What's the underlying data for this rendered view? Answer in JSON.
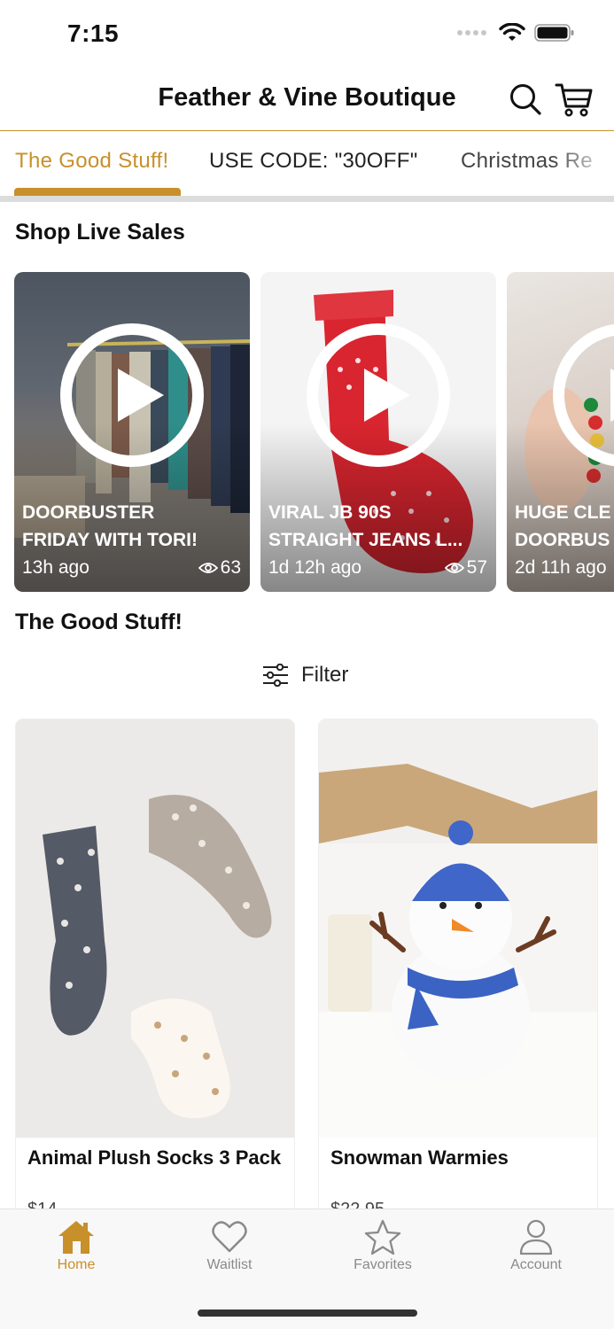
{
  "status_bar": {
    "time": "7:15"
  },
  "header": {
    "brand": "Feather & Vine Boutique",
    "search_icon": "search-icon",
    "cart_icon": "cart-icon"
  },
  "tabs": [
    {
      "label": "The Good Stuff!",
      "active": true
    },
    {
      "label": "USE CODE: \"30OFF\"",
      "active": false
    },
    {
      "label": "Christmas Re",
      "active": false
    }
  ],
  "live_section": {
    "title": "Shop Live Sales",
    "items": [
      {
        "title_line1": "DOORBUSTER",
        "title_line2": "FRIDAY WITH TORI!",
        "time": "13h ago",
        "views": "63"
      },
      {
        "title_line1": "VIRAL JB 90S",
        "title_line2": "STRAIGHT JEANS L...",
        "time": "1d 12h ago",
        "views": "57"
      },
      {
        "title_line1": "HUGE CLE",
        "title_line2": "DOORBUS",
        "time": "2d 11h ago",
        "views": ""
      }
    ]
  },
  "products_section": {
    "title": "The Good Stuff!",
    "filter_label": "Filter",
    "items": [
      {
        "name": "Animal Plush Socks 3 Pack",
        "price": "$14"
      },
      {
        "name": "Snowman Warmies",
        "price": "$22.95"
      }
    ]
  },
  "bottom_nav": [
    {
      "label": "Home",
      "icon": "home-icon",
      "active": true
    },
    {
      "label": "Waitlist",
      "icon": "heart-icon",
      "active": false
    },
    {
      "label": "Favorites",
      "icon": "star-icon",
      "active": false
    },
    {
      "label": "Account",
      "icon": "person-icon",
      "active": false
    }
  ],
  "colors": {
    "accent": "#c8902b",
    "text": "#111111",
    "inactive": "#8a8a8a"
  }
}
